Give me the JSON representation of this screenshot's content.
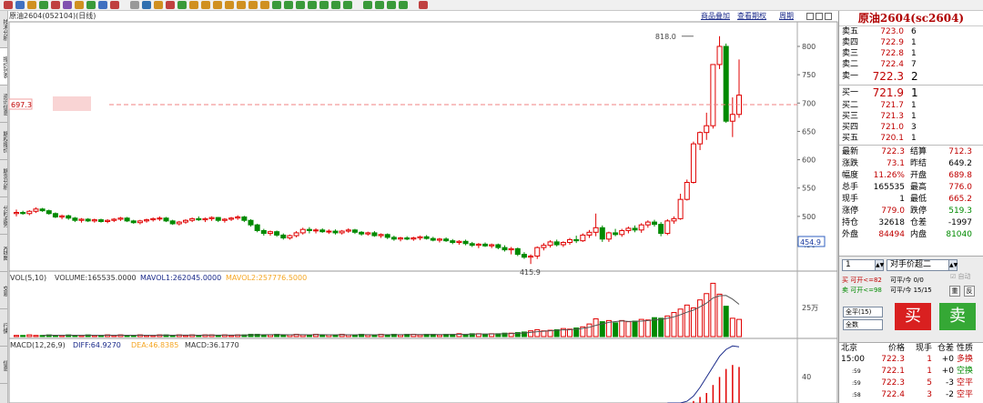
{
  "toolbar": {
    "icon_count": 34
  },
  "side_tabs": [
    "技术分析",
    "报价列表",
    "资讯信息",
    "期权报价",
    "期货分析",
    "分时走势",
    "K线图",
    "交易",
    "行情",
    "信息"
  ],
  "chart": {
    "title": "原油2604(052104)(日线)",
    "k_label": "K",
    "links": [
      "商品叠加",
      "查看期权",
      "周期"
    ],
    "price_axis": [
      "800",
      "750",
      "700",
      "650",
      "600",
      "550",
      "500",
      "450"
    ],
    "high_label": "818.0",
    "low_label": "415.9",
    "ref_price_label": "697.3",
    "ref_price": 697.3,
    "cur_price_label": "454.9",
    "vol_header": {
      "name": "VOL(5,10)",
      "volume": "VOLUME:165535.0000",
      "mavol1": "MAVOL1:262045.0000",
      "mavol2": "MAVOL2:257776.5000"
    },
    "vol_axis_label": "25万",
    "macd_header": {
      "name": "MACD(12,26,9)",
      "diff": "DIFF:64.9270",
      "dea": "DEA:46.8385",
      "macd": "MACD:36.1770"
    },
    "macd_axis_label": "40",
    "colors": {
      "up": "#e00000",
      "down": "#008a00",
      "ref_line": "#f08080",
      "mavol2": "#f5a623"
    }
  },
  "chart_data": {
    "type": "candlestick",
    "ylim": [
      420,
      830
    ],
    "candles": [
      [
        505,
        512,
        500,
        507
      ],
      [
        507,
        510,
        503,
        505
      ],
      [
        505,
        511,
        502,
        509
      ],
      [
        509,
        516,
        506,
        513
      ],
      [
        513,
        515,
        508,
        510
      ],
      [
        510,
        512,
        503,
        505
      ],
      [
        505,
        507,
        497,
        499
      ],
      [
        499,
        503,
        495,
        501
      ],
      [
        501,
        503,
        494,
        497
      ],
      [
        497,
        499,
        490,
        493
      ],
      [
        493,
        497,
        489,
        495
      ],
      [
        495,
        497,
        490,
        492
      ],
      [
        492,
        496,
        489,
        494
      ],
      [
        494,
        496,
        489,
        491
      ],
      [
        491,
        495,
        488,
        493
      ],
      [
        493,
        497,
        490,
        495
      ],
      [
        495,
        499,
        492,
        497
      ],
      [
        497,
        499,
        490,
        492
      ],
      [
        492,
        494,
        487,
        489
      ],
      [
        489,
        494,
        486,
        492
      ],
      [
        492,
        496,
        489,
        494
      ],
      [
        494,
        498,
        491,
        496
      ],
      [
        496,
        500,
        492,
        497
      ],
      [
        497,
        499,
        490,
        492
      ],
      [
        492,
        494,
        485,
        487
      ],
      [
        487,
        492,
        484,
        490
      ],
      [
        490,
        495,
        487,
        493
      ],
      [
        493,
        498,
        490,
        496
      ],
      [
        496,
        500,
        492,
        494
      ],
      [
        494,
        498,
        490,
        496
      ],
      [
        496,
        500,
        492,
        498
      ],
      [
        498,
        499,
        490,
        493
      ],
      [
        493,
        497,
        489,
        495
      ],
      [
        495,
        499,
        492,
        497
      ],
      [
        497,
        502,
        494,
        499
      ],
      [
        499,
        501,
        490,
        493
      ],
      [
        493,
        495,
        482,
        485
      ],
      [
        485,
        487,
        472,
        475
      ],
      [
        475,
        478,
        466,
        470
      ],
      [
        470,
        475,
        466,
        473
      ],
      [
        473,
        475,
        464,
        467
      ],
      [
        467,
        470,
        459,
        462
      ],
      [
        462,
        468,
        459,
        466
      ],
      [
        466,
        474,
        463,
        471
      ],
      [
        471,
        480,
        468,
        477
      ],
      [
        477,
        481,
        470,
        475
      ],
      [
        475,
        479,
        470,
        476
      ],
      [
        476,
        479,
        471,
        473
      ],
      [
        473,
        477,
        469,
        474
      ],
      [
        474,
        477,
        468,
        471
      ],
      [
        471,
        476,
        468,
        474
      ],
      [
        474,
        479,
        471,
        476
      ],
      [
        476,
        478,
        469,
        472
      ],
      [
        472,
        474,
        466,
        469
      ],
      [
        469,
        473,
        466,
        471
      ],
      [
        471,
        474,
        464,
        466
      ],
      [
        466,
        470,
        462,
        468
      ],
      [
        468,
        470,
        460,
        463
      ],
      [
        463,
        466,
        457,
        460
      ],
      [
        460,
        464,
        456,
        462
      ],
      [
        462,
        465,
        458,
        460
      ],
      [
        460,
        464,
        457,
        462
      ],
      [
        462,
        466,
        458,
        464
      ],
      [
        464,
        467,
        459,
        461
      ],
      [
        461,
        464,
        456,
        458
      ],
      [
        458,
        462,
        454,
        460
      ],
      [
        460,
        463,
        455,
        457
      ],
      [
        457,
        460,
        451,
        454
      ],
      [
        454,
        458,
        450,
        456
      ],
      [
        456,
        459,
        449,
        452
      ],
      [
        452,
        455,
        446,
        449
      ],
      [
        449,
        453,
        444,
        451
      ],
      [
        451,
        454,
        446,
        448
      ],
      [
        448,
        452,
        444,
        450
      ],
      [
        450,
        452,
        442,
        445
      ],
      [
        445,
        449,
        438,
        441
      ],
      [
        441,
        446,
        433,
        443
      ],
      [
        443,
        445,
        430,
        433
      ],
      [
        433,
        437,
        425,
        428
      ],
      [
        428,
        433,
        416,
        430
      ],
      [
        430,
        447,
        425,
        445
      ],
      [
        445,
        453,
        440,
        449
      ],
      [
        449,
        458,
        445,
        455
      ],
      [
        455,
        459,
        447,
        450
      ],
      [
        450,
        456,
        446,
        454
      ],
      [
        454,
        462,
        450,
        459
      ],
      [
        459,
        466,
        453,
        457
      ],
      [
        457,
        470,
        455,
        467
      ],
      [
        467,
        476,
        462,
        472
      ],
      [
        472,
        505,
        465,
        480
      ],
      [
        480,
        484,
        455,
        460
      ],
      [
        460,
        473,
        455,
        471
      ],
      [
        471,
        478,
        465,
        468
      ],
      [
        468,
        478,
        464,
        475
      ],
      [
        475,
        482,
        470,
        479
      ],
      [
        479,
        484,
        472,
        476
      ],
      [
        476,
        488,
        471,
        485
      ],
      [
        485,
        493,
        480,
        490
      ],
      [
        490,
        494,
        482,
        486
      ],
      [
        486,
        490,
        465,
        470
      ],
      [
        470,
        495,
        467,
        492
      ],
      [
        492,
        500,
        487,
        496
      ],
      [
        496,
        540,
        494,
        530
      ],
      [
        530,
        565,
        528,
        560
      ],
      [
        560,
        632,
        558,
        628
      ],
      [
        628,
        650,
        617,
        648
      ],
      [
        648,
        683,
        635,
        660
      ],
      [
        660,
        768,
        655,
        768
      ],
      [
        768,
        818,
        760,
        800
      ],
      [
        800,
        805,
        665,
        668
      ],
      [
        668,
        710,
        640,
        680
      ],
      [
        680,
        777,
        674,
        714
      ]
    ],
    "volume": [
      0.2,
      0.2,
      0.3,
      0.2,
      0.2,
      0.3,
      0.2,
      0.2,
      0.3,
      0.2,
      0.2,
      0.3,
      0.2,
      0.2,
      0.3,
      0.2,
      0.3,
      0.2,
      0.2,
      0.3,
      0.2,
      0.2,
      0.3,
      0.3,
      0.2,
      0.3,
      0.2,
      0.3,
      0.2,
      0.3,
      0.3,
      0.2,
      0.3,
      0.2,
      0.3,
      0.3,
      0.4,
      0.4,
      0.3,
      0.3,
      0.4,
      0.3,
      0.3,
      0.4,
      0.3,
      0.3,
      0.4,
      0.3,
      0.3,
      0.3,
      0.4,
      0.3,
      0.3,
      0.4,
      0.3,
      0.3,
      0.4,
      0.3,
      0.4,
      0.3,
      0.4,
      0.4,
      0.3,
      0.4,
      0.4,
      0.3,
      0.4,
      0.4,
      0.5,
      0.4,
      0.5,
      0.5,
      0.4,
      0.5,
      0.5,
      0.6,
      0.6,
      0.7,
      0.8,
      1.0,
      1.2,
      1.0,
      1.1,
      1.2,
      1.4,
      1.3,
      1.5,
      1.7,
      2.2,
      3.1,
      2.6,
      2.8,
      2.4,
      2.8,
      2.6,
      2.7,
      3.0,
      2.9,
      3.3,
      3.2,
      3.6,
      4.2,
      4.8,
      5.5,
      5.0,
      6.4,
      7.5,
      9.3,
      7.4,
      5.3,
      3.2,
      3.0
    ],
    "macd_hist": [
      0,
      0,
      0,
      0,
      0,
      0,
      0,
      0,
      0,
      0,
      0,
      0,
      0,
      0,
      0,
      0,
      0,
      0,
      0,
      0,
      0,
      0,
      0,
      0,
      0,
      0,
      0,
      0,
      0,
      0,
      0,
      0,
      0,
      0,
      0,
      0,
      0,
      0,
      0,
      0,
      0,
      0,
      0,
      0,
      0,
      0,
      0,
      0,
      0,
      0,
      0,
      0,
      0,
      0,
      0,
      0,
      0,
      0,
      0,
      0,
      0,
      0,
      0,
      0,
      0,
      0,
      0,
      0,
      0,
      0,
      0,
      0,
      0,
      0,
      0,
      0,
      0,
      0,
      0,
      0,
      0,
      0,
      0,
      0,
      0,
      0,
      0,
      0,
      0,
      0,
      0,
      0,
      0,
      0,
      0,
      0,
      0,
      0,
      0,
      0,
      0,
      0,
      0,
      0,
      2,
      6,
      10,
      18,
      26,
      34,
      38,
      36
    ],
    "diff": [
      0,
      0,
      0,
      0,
      0,
      0,
      0,
      0,
      0,
      0,
      0,
      0,
      0,
      0,
      0,
      0,
      0,
      0,
      0,
      0,
      0,
      0,
      0,
      0,
      0,
      0,
      0,
      0,
      0,
      0,
      0,
      0,
      0,
      0,
      0,
      0,
      0,
      0,
      0,
      0,
      0,
      0,
      0,
      0,
      0,
      0,
      0,
      0,
      0,
      0,
      0,
      0,
      0,
      0,
      0,
      0,
      0,
      0,
      0,
      0,
      0,
      0,
      0,
      0,
      0,
      0,
      0,
      0,
      0,
      0,
      0,
      0,
      0,
      0,
      0,
      0,
      0,
      0,
      0,
      0,
      0,
      0,
      0,
      0,
      0,
      0,
      0,
      0,
      0,
      0,
      0,
      0,
      0,
      0,
      0,
      0,
      0,
      0,
      0,
      0,
      0,
      0,
      0,
      2,
      8,
      18,
      30,
      42,
      54,
      62,
      66,
      65
    ]
  },
  "panel": {
    "title": "原油2604(sc2604)",
    "asks": [
      {
        "label": "卖五",
        "price": "723.0",
        "qty": "6"
      },
      {
        "label": "卖四",
        "price": "722.9",
        "qty": "1"
      },
      {
        "label": "卖三",
        "price": "722.8",
        "qty": "1"
      },
      {
        "label": "卖二",
        "price": "722.4",
        "qty": "7"
      },
      {
        "label": "卖一",
        "price": "722.3",
        "qty": "2"
      }
    ],
    "bids": [
      {
        "label": "买一",
        "price": "721.9",
        "qty": "1"
      },
      {
        "label": "买二",
        "price": "721.7",
        "qty": "1"
      },
      {
        "label": "买三",
        "price": "721.3",
        "qty": "1"
      },
      {
        "label": "买四",
        "price": "721.0",
        "qty": "3"
      },
      {
        "label": "买五",
        "price": "720.1",
        "qty": "1"
      }
    ],
    "stats": [
      {
        "l1": "最新",
        "v1": "722.3",
        "c1": "red",
        "l2": "结算",
        "v2": "712.3",
        "c2": "red"
      },
      {
        "l1": "涨跌",
        "v1": "73.1",
        "c1": "red",
        "l2": "昨结",
        "v2": "649.2",
        "c2": ""
      },
      {
        "l1": "幅度",
        "v1": "11.26%",
        "c1": "red",
        "l2": "开盘",
        "v2": "689.8",
        "c2": "red"
      },
      {
        "l1": "总手",
        "v1": "165535",
        "c1": "",
        "l2": "最高",
        "v2": "776.0",
        "c2": "red"
      },
      {
        "l1": "现手",
        "v1": "1",
        "c1": "",
        "l2": "最低",
        "v2": "665.2",
        "c2": "red"
      },
      {
        "l1": "涨停",
        "v1": "779.0",
        "c1": "red",
        "l2": "跌停",
        "v2": "519.3",
        "c2": "green"
      },
      {
        "l1": "持仓",
        "v1": "32618",
        "c1": "",
        "l2": "仓差",
        "v2": "-1997",
        "c2": ""
      },
      {
        "l1": "外盘",
        "v1": "84494",
        "c1": "red",
        "l2": "内盘",
        "v2": "81040",
        "c2": "green"
      }
    ],
    "order": {
      "qty": "1",
      "price_type": "对手价超二",
      "auto_label": "自动",
      "buy_open": "买 可开<=82",
      "sell_open": "卖 可开<=98",
      "buy_close": "可平/今 0/0",
      "sell_close": "可平/今 15/15",
      "btn_reset": "重",
      "btn_flat": "反",
      "close_all": "全平(15)",
      "all_label": "全数",
      "buy_btn": "买",
      "sell_btn": "卖"
    },
    "ticks_header": [
      "北京",
      "价格",
      "现手",
      "仓差",
      "性质"
    ],
    "ticks": [
      {
        "time": "15:00",
        "price": "722.3",
        "vol": "1",
        "oi": "+0",
        "nature": "多换",
        "nc": "red"
      },
      {
        "time": ":59",
        "price": "722.1",
        "vol": "1",
        "oi": "+0",
        "nature": "空换",
        "nc": "green"
      },
      {
        "time": ":59",
        "price": "722.3",
        "vol": "5",
        "oi": "-3",
        "nature": "空平",
        "nc": "red"
      },
      {
        "time": ":58",
        "price": "722.4",
        "vol": "3",
        "oi": "-2",
        "nature": "空平",
        "nc": "red"
      }
    ]
  }
}
